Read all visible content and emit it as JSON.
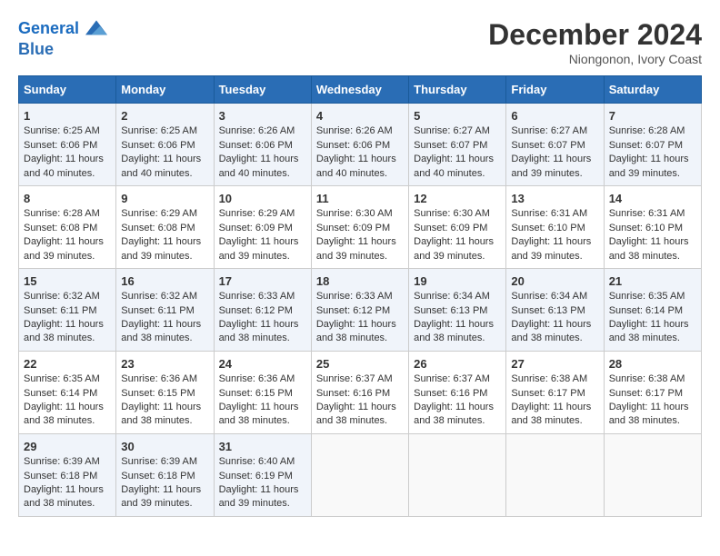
{
  "header": {
    "logo_line1": "General",
    "logo_line2": "Blue",
    "month": "December 2024",
    "location": "Niongonon, Ivory Coast"
  },
  "days_of_week": [
    "Sunday",
    "Monday",
    "Tuesday",
    "Wednesday",
    "Thursday",
    "Friday",
    "Saturday"
  ],
  "weeks": [
    [
      {
        "day": "1",
        "rise": "6:25 AM",
        "set": "6:06 PM",
        "hours": "11 hours and 40 minutes."
      },
      {
        "day": "2",
        "rise": "6:25 AM",
        "set": "6:06 PM",
        "hours": "11 hours and 40 minutes."
      },
      {
        "day": "3",
        "rise": "6:26 AM",
        "set": "6:06 PM",
        "hours": "11 hours and 40 minutes."
      },
      {
        "day": "4",
        "rise": "6:26 AM",
        "set": "6:06 PM",
        "hours": "11 hours and 40 minutes."
      },
      {
        "day": "5",
        "rise": "6:27 AM",
        "set": "6:07 PM",
        "hours": "11 hours and 40 minutes."
      },
      {
        "day": "6",
        "rise": "6:27 AM",
        "set": "6:07 PM",
        "hours": "11 hours and 39 minutes."
      },
      {
        "day": "7",
        "rise": "6:28 AM",
        "set": "6:07 PM",
        "hours": "11 hours and 39 minutes."
      }
    ],
    [
      {
        "day": "8",
        "rise": "6:28 AM",
        "set": "6:08 PM",
        "hours": "11 hours and 39 minutes."
      },
      {
        "day": "9",
        "rise": "6:29 AM",
        "set": "6:08 PM",
        "hours": "11 hours and 39 minutes."
      },
      {
        "day": "10",
        "rise": "6:29 AM",
        "set": "6:09 PM",
        "hours": "11 hours and 39 minutes."
      },
      {
        "day": "11",
        "rise": "6:30 AM",
        "set": "6:09 PM",
        "hours": "11 hours and 39 minutes."
      },
      {
        "day": "12",
        "rise": "6:30 AM",
        "set": "6:09 PM",
        "hours": "11 hours and 39 minutes."
      },
      {
        "day": "13",
        "rise": "6:31 AM",
        "set": "6:10 PM",
        "hours": "11 hours and 39 minutes."
      },
      {
        "day": "14",
        "rise": "6:31 AM",
        "set": "6:10 PM",
        "hours": "11 hours and 38 minutes."
      }
    ],
    [
      {
        "day": "15",
        "rise": "6:32 AM",
        "set": "6:11 PM",
        "hours": "11 hours and 38 minutes."
      },
      {
        "day": "16",
        "rise": "6:32 AM",
        "set": "6:11 PM",
        "hours": "11 hours and 38 minutes."
      },
      {
        "day": "17",
        "rise": "6:33 AM",
        "set": "6:12 PM",
        "hours": "11 hours and 38 minutes."
      },
      {
        "day": "18",
        "rise": "6:33 AM",
        "set": "6:12 PM",
        "hours": "11 hours and 38 minutes."
      },
      {
        "day": "19",
        "rise": "6:34 AM",
        "set": "6:13 PM",
        "hours": "11 hours and 38 minutes."
      },
      {
        "day": "20",
        "rise": "6:34 AM",
        "set": "6:13 PM",
        "hours": "11 hours and 38 minutes."
      },
      {
        "day": "21",
        "rise": "6:35 AM",
        "set": "6:14 PM",
        "hours": "11 hours and 38 minutes."
      }
    ],
    [
      {
        "day": "22",
        "rise": "6:35 AM",
        "set": "6:14 PM",
        "hours": "11 hours and 38 minutes."
      },
      {
        "day": "23",
        "rise": "6:36 AM",
        "set": "6:15 PM",
        "hours": "11 hours and 38 minutes."
      },
      {
        "day": "24",
        "rise": "6:36 AM",
        "set": "6:15 PM",
        "hours": "11 hours and 38 minutes."
      },
      {
        "day": "25",
        "rise": "6:37 AM",
        "set": "6:16 PM",
        "hours": "11 hours and 38 minutes."
      },
      {
        "day": "26",
        "rise": "6:37 AM",
        "set": "6:16 PM",
        "hours": "11 hours and 38 minutes."
      },
      {
        "day": "27",
        "rise": "6:38 AM",
        "set": "6:17 PM",
        "hours": "11 hours and 38 minutes."
      },
      {
        "day": "28",
        "rise": "6:38 AM",
        "set": "6:17 PM",
        "hours": "11 hours and 38 minutes."
      }
    ],
    [
      {
        "day": "29",
        "rise": "6:39 AM",
        "set": "6:18 PM",
        "hours": "11 hours and 38 minutes."
      },
      {
        "day": "30",
        "rise": "6:39 AM",
        "set": "6:18 PM",
        "hours": "11 hours and 39 minutes."
      },
      {
        "day": "31",
        "rise": "6:40 AM",
        "set": "6:19 PM",
        "hours": "11 hours and 39 minutes."
      },
      null,
      null,
      null,
      null
    ]
  ],
  "labels": {
    "sunrise": "Sunrise:",
    "sunset": "Sunset:",
    "daylight": "Daylight:"
  }
}
